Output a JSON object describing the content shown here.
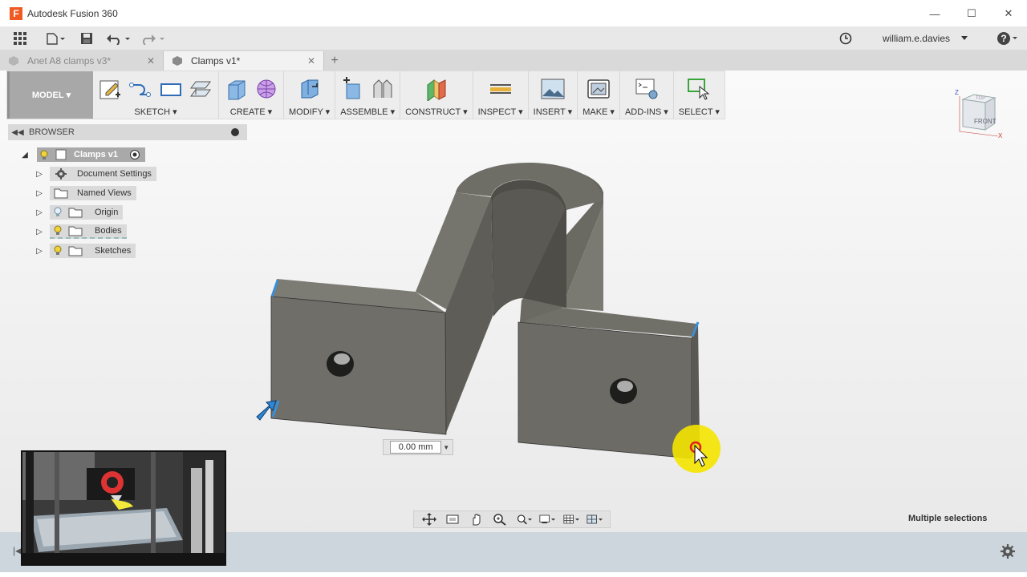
{
  "window": {
    "title": "Autodesk Fusion 360",
    "logo_letter": "F",
    "controls": [
      "—",
      "☐",
      "✕"
    ]
  },
  "appbar": {
    "user": "william.e.davies"
  },
  "tabs": [
    {
      "label": "Anet A8 clamps v3*",
      "active": false
    },
    {
      "label": "Clamps v1*",
      "active": true
    }
  ],
  "toolbar": {
    "workspace": "MODEL",
    "groups": [
      {
        "label": "SKETCH"
      },
      {
        "label": "CREATE"
      },
      {
        "label": "MODIFY"
      },
      {
        "label": "ASSEMBLE"
      },
      {
        "label": "CONSTRUCT"
      },
      {
        "label": "INSPECT"
      },
      {
        "label": "INSERT"
      },
      {
        "label": "MAKE"
      },
      {
        "label": "ADD-INS"
      },
      {
        "label": "SELECT"
      }
    ]
  },
  "browser": {
    "title": "BROWSER",
    "root": "Clamps v1",
    "items": [
      {
        "label": "Document Settings"
      },
      {
        "label": "Named Views"
      },
      {
        "label": "Origin"
      },
      {
        "label": "Bodies"
      },
      {
        "label": "Sketches"
      }
    ]
  },
  "viewcube": {
    "face_front": "FRONT",
    "face_top": "TOP",
    "axis_z": "Z",
    "axis_x": "X"
  },
  "dimension_input": {
    "value": "0.00 mm"
  },
  "status": {
    "selection_text": "Multiple selections"
  },
  "colors": {
    "model_gray": "#6b6a63",
    "selection_blue": "#3a8fd8",
    "highlight_yellow": "#f5e400"
  }
}
